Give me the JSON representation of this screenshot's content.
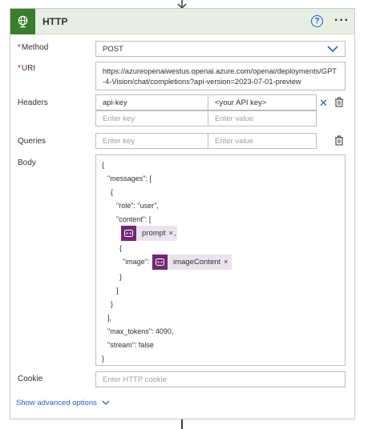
{
  "action": {
    "title": "HTTP",
    "icon": "globe-icon",
    "help_glyph": "?",
    "more_glyph": "···"
  },
  "fields": {
    "method": {
      "label": "Method",
      "required": "*",
      "value": "POST"
    },
    "uri": {
      "label": "URI",
      "required": "*",
      "value": "https://azureopenaiwestus.openai.azure.com/openai/deployments/GPT-4-Vision/chat/completions?api-version=2023-07-01-preview"
    },
    "headers": {
      "label": "Headers",
      "rows": [
        {
          "key": "api-key",
          "value": "<your API key>"
        }
      ],
      "key_placeholder": "Enter key",
      "value_placeholder": "Enter value"
    },
    "queries": {
      "label": "Queries",
      "key_placeholder": "Enter key",
      "value_placeholder": "Enter value"
    },
    "body": {
      "label": "Body",
      "lines": [
        "{",
        "\"messages\": [",
        "{",
        "\"role\": \"user\",",
        "\"content\": [",
        ",",
        "{",
        "\"image\":",
        "}",
        "]",
        "}",
        "],",
        "\"max_tokens\": 4090,",
        "\"stream\": false",
        "}"
      ],
      "tokens": [
        {
          "label": "prompt",
          "close": "×"
        },
        {
          "label": "imageContent",
          "close": "×"
        }
      ]
    },
    "cookie": {
      "label": "Cookie",
      "placeholder": "Enter HTTP cookie"
    }
  },
  "advanced": {
    "label": "Show advanced options"
  },
  "colors": {
    "header_bg": "#e6efe2",
    "header_icon_bg": "#3a7d2c",
    "token_icon_bg": "#742774",
    "link": "#2860c4",
    "required": "#a4262c"
  }
}
